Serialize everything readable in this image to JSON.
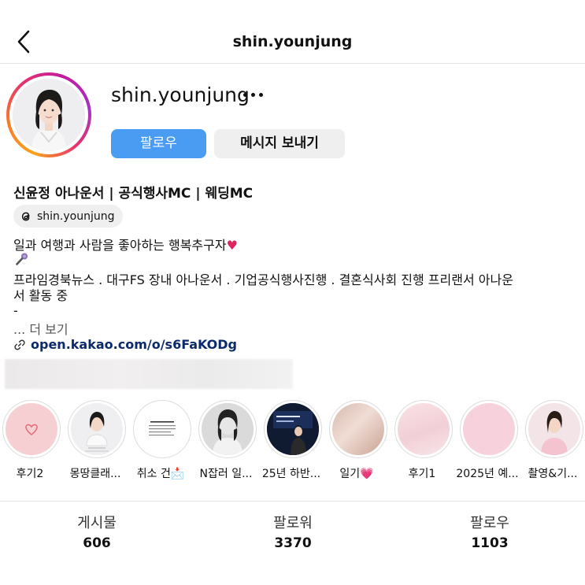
{
  "header": {
    "title": "shin.younjung"
  },
  "profile": {
    "username": "shin.younjung",
    "follow_label": "팔로우",
    "message_label": "메시지 보내기"
  },
  "bio": {
    "name": "신윤정 아나운서 | 공식행사MC | 웨딩MC",
    "threads_handle": "shin.younjung",
    "line1": "일과 여행과 사람을 좋아하는 행복추구자",
    "line1_emoji": "♥",
    "line2": "프라임경북뉴스 . 대구FS 장내 아나운서 . 기업공식행사진행 . 결혼식사회 진행 프리랜서 아나운",
    "line3": "서 활동 중",
    "line4": "-",
    "more": "... 더 보기",
    "link": "open.kakao.com/o/s6FaKODg"
  },
  "highlights": [
    {
      "label": "후기2"
    },
    {
      "label": "몽땅클래..."
    },
    {
      "label": "취소 건📩"
    },
    {
      "label": "N잡러 일..."
    },
    {
      "label": "25년 하반..."
    },
    {
      "label": "일기💗"
    },
    {
      "label": "후기1"
    },
    {
      "label": "2025년 예..."
    },
    {
      "label": "촬영&기..."
    }
  ],
  "stats": {
    "posts_label": "게시물",
    "posts_value": "606",
    "followers_label": "팔로워",
    "followers_value": "3370",
    "following_label": "팔로우",
    "following_value": "1103"
  },
  "colors": {
    "follow_button": "#4a9cf3",
    "link": "#0b2a6b",
    "heart": "#e0245e"
  }
}
